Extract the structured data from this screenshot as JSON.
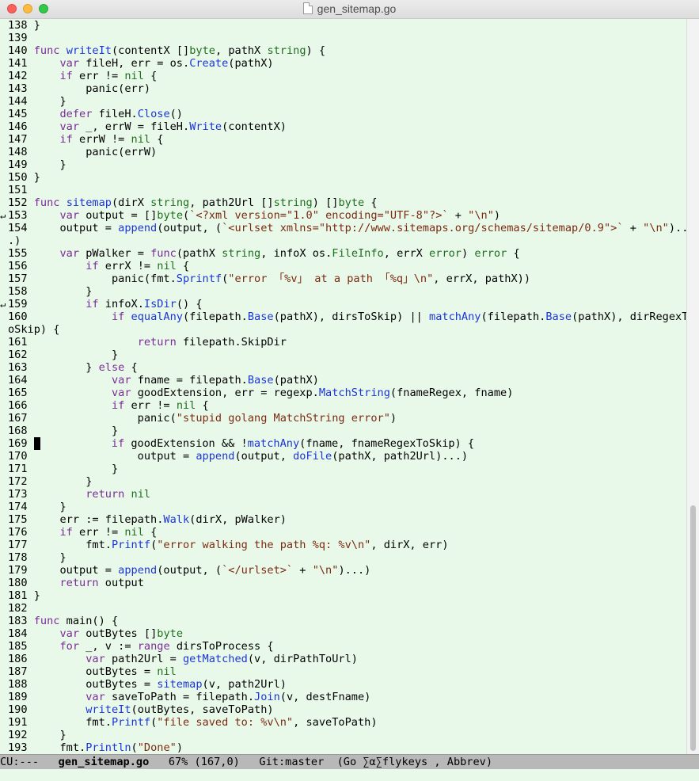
{
  "window": {
    "title": "gen_sitemap.go"
  },
  "code_lines": [
    "138 }",
    "139",
    "140 func writeIt(contentX []byte, pathX string) {",
    "141     var fileH, err = os.Create(pathX)",
    "142     if err != nil {",
    "143         panic(err)",
    "144     }",
    "145     defer fileH.Close()",
    "146     var _, errW = fileH.Write(contentX)",
    "147     if errW != nil {",
    "148         panic(errW)",
    "149     }",
    "150 }",
    "151",
    "152 func sitemap(dirX string, path2Url []string) []byte {",
    "153     var output = []byte(`<?xml version=\"1.0\" encoding=\"UTF-8\"?>` + \"\\n\")",
    "154     output = append(output, (`<urlset xmlns=\"http://www.sitemaps.org/schemas/sitemap/0.9\">` + \"\\n\")..",
    ".)",
    "155     var pWalker = func(pathX string, infoX os.FileInfo, errX error) error {",
    "156         if errX != nil {",
    "157             panic(fmt.Sprintf(\"error 「%v」 at a path 「%q」\\n\", errX, pathX))",
    "158         }",
    "159         if infoX.IsDir() {",
    "160             if equalAny(filepath.Base(pathX), dirsToSkip) || matchAny(filepath.Base(pathX), dirRegexT",
    "oSkip) {",
    "161                 return filepath.SkipDir",
    "162             }",
    "163         } else {",
    "164             var fname = filepath.Base(pathX)",
    "165             var goodExtension, err = regexp.MatchString(fnameRegex, fname)",
    "166             if err != nil {",
    "167                 panic(\"stupid golang MatchString error\")",
    "168             }",
    "169             if goodExtension && !matchAny(fname, fnameRegexToSkip) {",
    "170                 output = append(output, doFile(pathX, path2Url)...)",
    "171             }",
    "172         }",
    "173         return nil",
    "174     }",
    "175     err := filepath.Walk(dirX, pWalker)",
    "176     if err != nil {",
    "177         fmt.Printf(\"error walking the path %q: %v\\n\", dirX, err)",
    "178     }",
    "179     output = append(output, (`</urlset>` + \"\\n\")...)",
    "180     return output",
    "181 }",
    "182",
    "183 func main() {",
    "184     var outBytes []byte",
    "185     for _, v := range dirsToProcess {",
    "186         var path2Url = getMatched(v, dirPathToUrl)",
    "187         outBytes = nil",
    "188         outBytes = sitemap(v, path2Url)",
    "189         var saveToPath = filepath.Join(v, destFname)",
    "190         writeIt(outBytes, saveToPath)",
    "191         fmt.Printf(\"file saved to: %v\\n\", saveToPath)",
    "192     }",
    "193     fmt.Println(\"Done\")"
  ],
  "cursor_line_index": 33,
  "wrap_mark_rows": [
    16,
    23
  ],
  "modeline": {
    "status": "CU:---",
    "buffer_name": "gen_sitemap.go",
    "position": "67% (167,0)",
    "vc": "Git:master",
    "modes": "(Go ∑α∑flykeys , Abbrev)"
  },
  "scroll": {
    "position_fraction": 0.67
  },
  "colors": {
    "background": "#e9f9e9",
    "keyword": "#7a2b97",
    "type": "#1f6e1f",
    "function": "#1a35d6",
    "string": "#7b2a10",
    "modeline_bg": "#b8b8b8"
  }
}
